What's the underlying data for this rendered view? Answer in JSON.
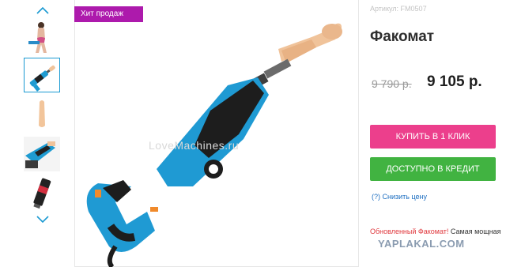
{
  "badge": {
    "label": "Хит продаж"
  },
  "watermark": {
    "text": "LoveMachines.ru"
  },
  "product": {
    "sku": "Артикул: FM0507",
    "title": "Факомат",
    "old_price": "9 790 р.",
    "new_price": "9 105 р.",
    "buy_one_click": "КУПИТЬ В 1 КЛИК",
    "credit": "ДОСТУПНО В КРЕДИТ",
    "price_drop": "(?) Снизить цену",
    "description_highlight": "Обновленный Факомат!",
    "description_rest": " Самая мощная"
  },
  "gallery": {
    "thumbnails": [
      {
        "icon": "model-photo"
      },
      {
        "icon": "device-photo",
        "active": true
      },
      {
        "icon": "attachment-photo"
      },
      {
        "icon": "device-closeup-photo"
      },
      {
        "icon": "lubricant-photo"
      }
    ]
  },
  "site_watermark": {
    "text": "YAPLAKAL.COM"
  },
  "colors": {
    "badge": "#ad1aac",
    "buy_button": "#ec3f8c",
    "credit_button": "#41b341",
    "link": "#1b6dc0",
    "highlight": "#e0393e"
  }
}
